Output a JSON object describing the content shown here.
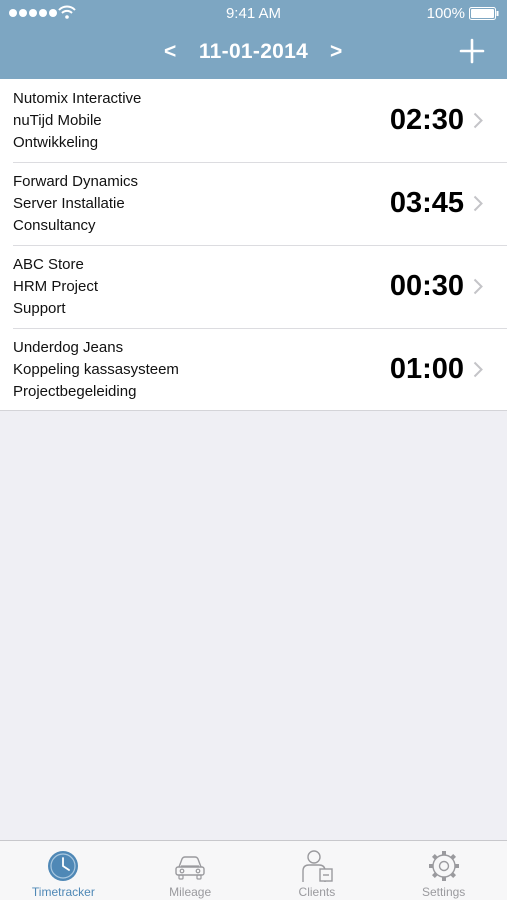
{
  "status_bar": {
    "time": "9:41 AM",
    "battery": "100%"
  },
  "nav": {
    "prev": "<",
    "date": "11-01-2014",
    "next": ">"
  },
  "entries": [
    {
      "client": "Nutomix Interactive",
      "project": "nuTijd Mobile",
      "activity": "Ontwikkeling",
      "duration": "02:30"
    },
    {
      "client": "Forward Dynamics",
      "project": "Server Installatie",
      "activity": "Consultancy",
      "duration": "03:45"
    },
    {
      "client": "ABC Store",
      "project": "HRM Project",
      "activity": "Support",
      "duration": "00:30"
    },
    {
      "client": "Underdog Jeans",
      "project": "Koppeling kassasysteem",
      "activity": "Projectbegeleiding",
      "duration": "01:00"
    }
  ],
  "tabs": [
    {
      "label": "Timetracker",
      "icon": "clock-icon",
      "active": true
    },
    {
      "label": "Mileage",
      "icon": "car-icon",
      "active": false
    },
    {
      "label": "Clients",
      "icon": "person-icon",
      "active": false
    },
    {
      "label": "Settings",
      "icon": "gear-icon",
      "active": false
    }
  ],
  "colors": {
    "header": "#7da6c2",
    "accent": "#4f88b6",
    "background": "#efeff4"
  }
}
